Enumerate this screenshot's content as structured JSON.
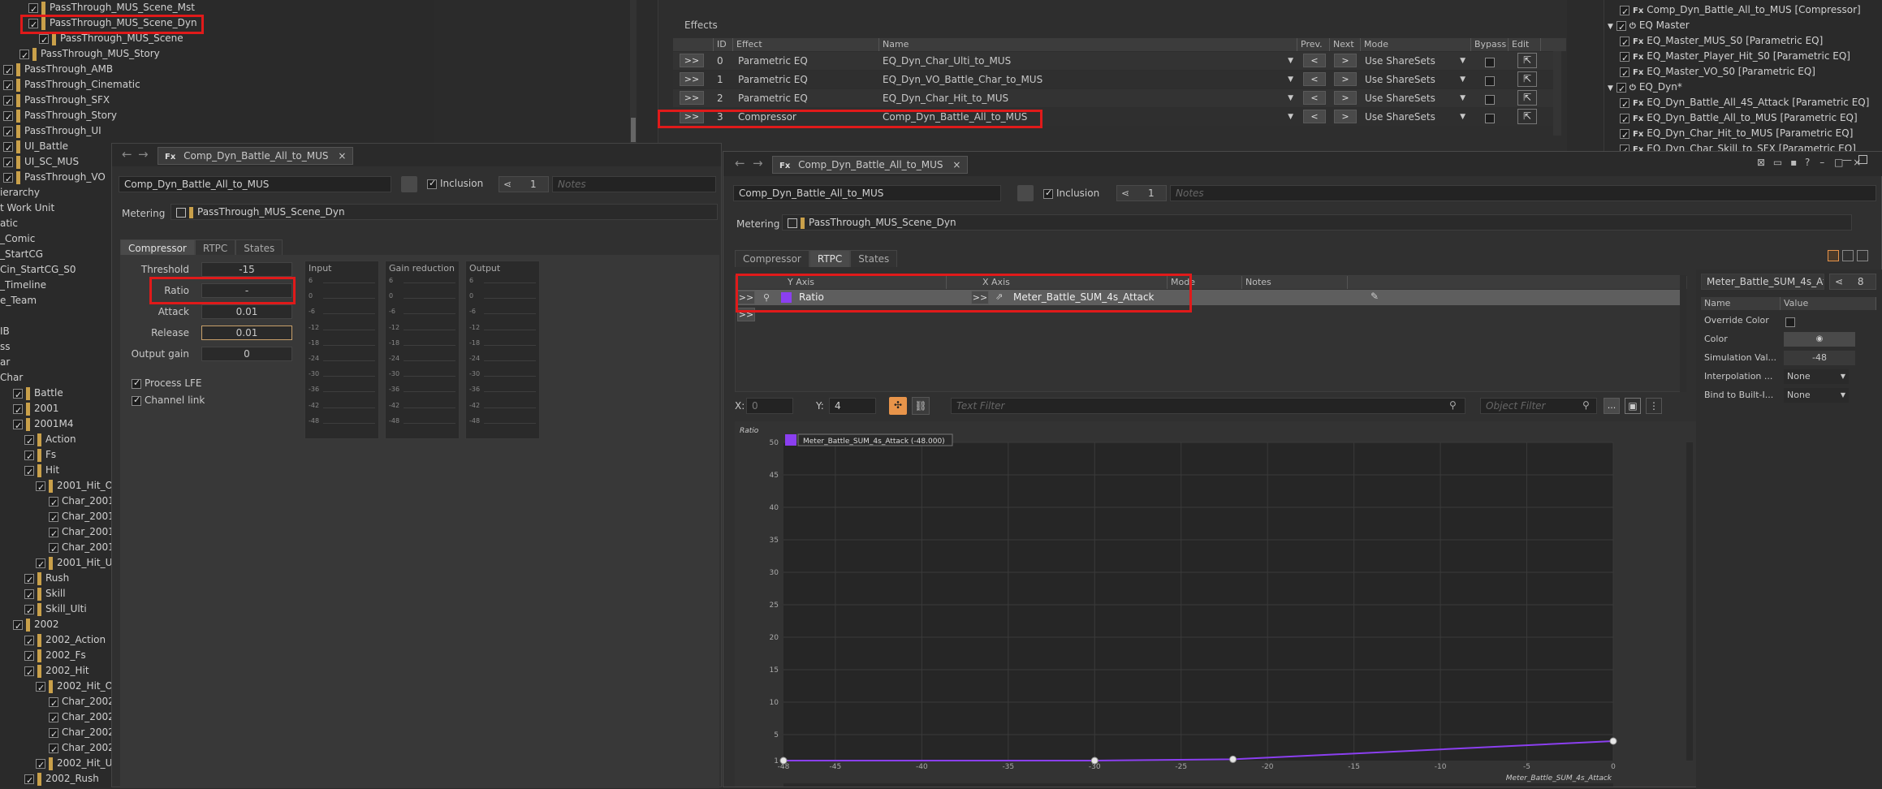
{
  "tree": {
    "rows": [
      {
        "label": "PassThrough_MUS_Scene_Mst",
        "indent": 35,
        "folder": true
      },
      {
        "label": "PassThrough_MUS_Scene_Dyn",
        "indent": 35,
        "folder": true
      },
      {
        "label": "PassThrough_MUS_Scene",
        "indent": 48,
        "folder": true
      },
      {
        "label": "PassThrough_MUS_Story",
        "indent": 24,
        "folder": true
      },
      {
        "label": "PassThrough_AMB",
        "indent": 4,
        "folder": true
      },
      {
        "label": "PassThrough_Cinematic",
        "indent": 4,
        "folder": true
      },
      {
        "label": "PassThrough_SFX",
        "indent": 4,
        "folder": true
      },
      {
        "label": "PassThrough_Story",
        "indent": 4,
        "folder": true
      },
      {
        "label": "PassThrough_UI",
        "indent": 4,
        "folder": true
      },
      {
        "label": "UI_Battle",
        "indent": 4,
        "folder": true
      },
      {
        "label": "UI_SC_MUS",
        "indent": 4,
        "folder": true
      },
      {
        "label": "PassThrough_VO",
        "indent": 4,
        "folder": true
      },
      {
        "label": "ierarchy",
        "indent": 0,
        "folder": false
      },
      {
        "label": "t Work Unit",
        "indent": 0,
        "folder": false
      },
      {
        "label": "atic",
        "indent": 0,
        "folder": false
      },
      {
        "label": "_Comic",
        "indent": 0,
        "folder": false
      },
      {
        "label": "_StartCG",
        "indent": 0,
        "folder": false
      },
      {
        "label": "Cin_StartCG_S0",
        "indent": 0,
        "folder": false
      },
      {
        "label": "_Timeline",
        "indent": 0,
        "folder": false
      },
      {
        "label": "e_Team",
        "indent": 0,
        "folder": false
      },
      {
        "label": "",
        "indent": 0,
        "folder": false
      },
      {
        "label": "IB",
        "indent": 0,
        "folder": false
      },
      {
        "label": "ss",
        "indent": 0,
        "folder": false
      },
      {
        "label": "ar",
        "indent": 0,
        "folder": false
      },
      {
        "label": "Char",
        "indent": 0,
        "folder": false
      },
      {
        "label": "Battle",
        "indent": 16,
        "folder": true
      },
      {
        "label": "2001",
        "indent": 16,
        "folder": true
      },
      {
        "label": "2001M4",
        "indent": 16,
        "folder": true
      },
      {
        "label": "Action",
        "indent": 30,
        "folder": true
      },
      {
        "label": "Fs",
        "indent": 30,
        "folder": true
      },
      {
        "label": "Hit",
        "indent": 30,
        "folder": true
      },
      {
        "label": "2001_Hit_Oth",
        "indent": 44,
        "folder": true
      },
      {
        "label": "Char_2001",
        "indent": 60,
        "folder": false
      },
      {
        "label": "Char_2001",
        "indent": 60,
        "folder": false
      },
      {
        "label": "Char_2001",
        "indent": 60,
        "folder": false
      },
      {
        "label": "Char_2001",
        "indent": 60,
        "folder": false
      },
      {
        "label": "2001_Hit_Ulti",
        "indent": 44,
        "folder": true
      },
      {
        "label": "Rush",
        "indent": 30,
        "folder": true
      },
      {
        "label": "Skill",
        "indent": 30,
        "folder": true
      },
      {
        "label": "Skill_Ulti",
        "indent": 30,
        "folder": true
      },
      {
        "label": "2002",
        "indent": 16,
        "folder": true
      },
      {
        "label": "2002_Action",
        "indent": 30,
        "folder": true
      },
      {
        "label": "2002_Fs",
        "indent": 30,
        "folder": true
      },
      {
        "label": "2002_Hit",
        "indent": 30,
        "folder": true
      },
      {
        "label": "2002_Hit_Oth",
        "indent": 44,
        "folder": true
      },
      {
        "label": "Char_2002",
        "indent": 60,
        "folder": false
      },
      {
        "label": "Char_2002",
        "indent": 60,
        "folder": false
      },
      {
        "label": "Char_2002",
        "indent": 60,
        "folder": false
      },
      {
        "label": "Char_2002",
        "indent": 60,
        "folder": false
      },
      {
        "label": "2002_Hit_Ulti",
        "indent": 44,
        "folder": true
      },
      {
        "label": "2002_Rush",
        "indent": 30,
        "folder": true
      }
    ]
  },
  "effects": {
    "title": "Effects",
    "headers": {
      "id": "ID",
      "effect": "Effect",
      "name": "Name",
      "prev": "Prev.",
      "next": "Next",
      "mode": "Mode",
      "bypass": "Bypass",
      "edit": "Edit"
    },
    "rows": [
      {
        "id": "0",
        "effect": "Parametric EQ",
        "name": "EQ_Dyn_Char_Ulti_to_MUS",
        "mode": "Use ShareSets"
      },
      {
        "id": "1",
        "effect": "Parametric EQ",
        "name": "EQ_Dyn_VO_Battle_Char_to_MUS",
        "mode": "Use ShareSets"
      },
      {
        "id": "2",
        "effect": "Parametric EQ",
        "name": "EQ_Dyn_Char_Hit_to_MUS",
        "mode": "Use ShareSets"
      },
      {
        "id": "3",
        "effect": "Compressor",
        "name": "Comp_Dyn_Battle_All_to_MUS",
        "mode": "Use ShareSets"
      }
    ],
    "expand": ">>",
    "prev_btn": "<",
    "next_btn": ">"
  },
  "right_tree": {
    "rows": [
      {
        "label": "Comp_Dyn_Battle_All_to_MUS [Compressor]",
        "indent": 45
      },
      {
        "label": "EQ Master",
        "indent": 30
      },
      {
        "label": "EQ_Master_MUS_S0 [Parametric EQ]",
        "indent": 45
      },
      {
        "label": "EQ_Master_Player_Hit_S0 [Parametric EQ]",
        "indent": 45
      },
      {
        "label": "EQ_Master_VO_S0 [Parametric EQ]",
        "indent": 45
      },
      {
        "label": "EQ_Dyn*",
        "indent": 30
      },
      {
        "label": "EQ_Dyn_Battle_All_4S_Attack [Parametric EQ]",
        "indent": 45
      },
      {
        "label": "EQ_Dyn_Battle_All_to_MUS [Parametric EQ]",
        "indent": 45
      },
      {
        "label": "EQ_Dyn_Char_Hit_to_MUS [Parametric EQ]",
        "indent": 45
      },
      {
        "label": "EQ_Dyn_Char_Skill_to_SFX [Parametric EQ]",
        "indent": 45
      }
    ]
  },
  "comp_left": {
    "tab_title": "Comp_Dyn_Battle_All_to_MUS",
    "name": "Comp_Dyn_Battle_All_to_MUS",
    "inclusion": "Inclusion",
    "count": "1",
    "notes": "Notes",
    "metering_label": "Metering",
    "metering_value": "PassThrough_MUS_Scene_Dyn",
    "tabs": [
      "Compressor",
      "RTPC",
      "States"
    ],
    "params": [
      {
        "label": "Threshold",
        "value": "-15"
      },
      {
        "label": "Ratio",
        "value": "-"
      },
      {
        "label": "Attack",
        "value": "0.01"
      },
      {
        "label": "Release",
        "value": "0.01"
      },
      {
        "label": "Output gain",
        "value": "0"
      }
    ],
    "process_lfe": "Process LFE",
    "channel_link": "Channel link",
    "meters": [
      {
        "title": "Input"
      },
      {
        "title": "Gain reduction"
      },
      {
        "title": "Output"
      }
    ],
    "meter_ticks": [
      "6",
      "0",
      "-6",
      "-12",
      "-18",
      "-24",
      "-30",
      "-36",
      "-42",
      "-48"
    ]
  },
  "comp_right": {
    "tab_title": "Comp_Dyn_Battle_All_to_MUS",
    "name": "Comp_Dyn_Battle_All_to_MUS",
    "inclusion": "Inclusion",
    "count": "1",
    "notes": "Notes",
    "metering_label": "Metering",
    "metering_value": "PassThrough_MUS_Scene_Dyn",
    "tabs": [
      "Compressor",
      "RTPC",
      "States"
    ],
    "rtpc_headers": {
      "y": "Y Axis",
      "x": "X Axis",
      "mode": "Mode",
      "notes": "Notes"
    },
    "rtpc_row": {
      "y": "Ratio",
      "x": "Meter_Battle_SUM_4s_Attack"
    },
    "expand": ">>",
    "x_label": "X:",
    "x_value": "0",
    "y_label": "Y:",
    "y_value": "4",
    "text_filter": "Text Filter",
    "object_filter": "Object Filter",
    "ellipsis": "...",
    "graph_y_title": "Ratio",
    "graph_legend": "Meter_Battle_SUM_4s_Attack (-48.000)",
    "graph_x_title": "Meter_Battle_SUM_4s_Attack"
  },
  "props": {
    "title": "Meter_Battle_SUM_4s_Attac",
    "count": "8",
    "headers": {
      "name": "Name",
      "value": "Value"
    },
    "rows": [
      {
        "name": "Override Color",
        "value": ""
      },
      {
        "name": "Color",
        "value": ""
      },
      {
        "name": "Simulation Val...",
        "value": "-48"
      },
      {
        "name": "Interpolation ...",
        "value": "None"
      },
      {
        "name": "Bind to Built-I...",
        "value": "None"
      }
    ]
  },
  "chart_data": {
    "type": "line",
    "title": "",
    "xlabel": "Meter_Battle_SUM_4s_Attack",
    "ylabel": "Ratio",
    "xlim": [
      -48,
      0
    ],
    "ylim": [
      1,
      50
    ],
    "x_ticks": [
      "-45",
      "-40",
      "-35",
      "-30",
      "-25",
      "-20",
      "-15",
      "-10",
      "-5",
      "0"
    ],
    "y_ticks": [
      "5",
      "10",
      "15",
      "20",
      "25",
      "30",
      "35",
      "40",
      "45",
      "50"
    ],
    "axis_end_labels": {
      "x_min": "-48",
      "y_min": "1"
    },
    "series": [
      {
        "name": "Meter_Battle_SUM_4s_Attack",
        "color": "#8b3ff0",
        "x": [
          -48,
          -30,
          -22,
          0
        ],
        "y": [
          1,
          1,
          1.2,
          4
        ]
      }
    ]
  },
  "colors": {
    "accent": "#8b3ff0",
    "highlight": "#e01a1a",
    "orange": "#e8944a"
  }
}
